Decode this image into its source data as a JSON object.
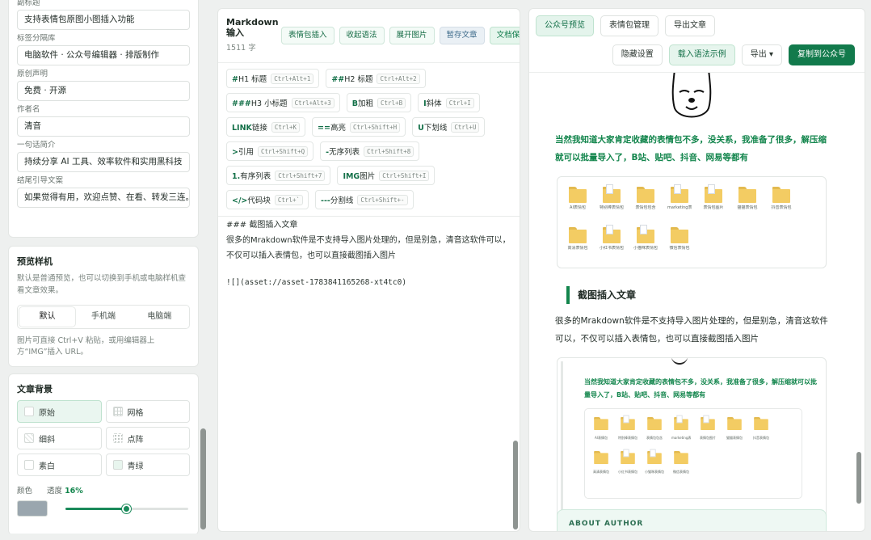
{
  "meta_fields": [
    {
      "label": "副标题",
      "value": "支持表情包原图小图插入功能"
    },
    {
      "label": "标签分隔库",
      "value": "电脑软件 · 公众号编辑器 · 排版制作"
    },
    {
      "label": "原创声明",
      "value": "免费 · 开源"
    },
    {
      "label": "作者名",
      "value": "清音"
    },
    {
      "label": "一句话简介",
      "value": "持续分享 AI 工具、效率软件和实用黑科技"
    },
    {
      "label": "结尾引导文案",
      "value": "如果觉得有用，欢迎点赞、在看、转发三连。"
    }
  ],
  "preview": {
    "title": "预览样机",
    "desc": "默认是普通预览，也可以切换到手机或电脑样机查看文章效果。",
    "tabs": [
      "默认",
      "手机端",
      "电脑端"
    ],
    "active_tab": 0,
    "hint": "图片可直接 Ctrl+V 粘贴，或用编辑器上方“IMG”插入 URL。"
  },
  "background": {
    "title": "文章背景",
    "options": [
      {
        "label": "原始",
        "swatch": "plain"
      },
      {
        "label": "网格",
        "swatch": "grid"
      },
      {
        "label": "细斜",
        "swatch": "stripe"
      },
      {
        "label": "点阵",
        "swatch": "dot"
      },
      {
        "label": "素白",
        "swatch": "plain"
      },
      {
        "label": "青绿",
        "swatch": "green"
      }
    ],
    "active": 0,
    "color_label": "颜色",
    "opacity_label": "透度",
    "opacity_value": "16%",
    "opacity_fraction": 0.5,
    "swatch_color": "#9aa6ae"
  },
  "editor": {
    "title": "Markdown 输入",
    "count": "1511 字",
    "actions": [
      "表情包插入",
      "收起语法",
      "展开图片",
      "暂存文章",
      "文档保存"
    ],
    "tools": [
      [
        {
          "key": "#",
          "label": "H1 标题",
          "kbd": "Ctrl+Alt+1"
        },
        {
          "key": "##",
          "label": "H2 标题",
          "kbd": "Ctrl+Alt+2"
        }
      ],
      [
        {
          "key": "###",
          "label": "H3 小标题",
          "kbd": "Ctrl+Alt+3"
        },
        {
          "key": "B",
          "label": "加粗",
          "kbd": "Ctrl+B"
        },
        {
          "key": "I",
          "label": "斜体",
          "kbd": "Ctrl+I"
        }
      ],
      [
        {
          "key": "LINK",
          "label": "链接",
          "kbd": "Ctrl+K"
        },
        {
          "key": "==",
          "label": "高亮",
          "kbd": "Ctrl+Shift+H"
        },
        {
          "key": "U",
          "label": "下划线",
          "kbd": "Ctrl+U"
        }
      ],
      [
        {
          "key": ">",
          "label": "引用",
          "kbd": "Ctrl+Shift+Q"
        },
        {
          "key": "-",
          "label": "无序列表",
          "kbd": "Ctrl+Shift+8"
        }
      ],
      [
        {
          "key": "1.",
          "label": "有序列表",
          "kbd": "Ctrl+Shift+7"
        },
        {
          "key": "IMG",
          "label": "图片",
          "kbd": "Ctrl+Shift+I"
        }
      ],
      [
        {
          "key": "</>",
          "label": "代码块",
          "kbd": "Ctrl+`"
        },
        {
          "key": "---",
          "label": "分割线",
          "kbd": "Ctrl+Shift+-"
        }
      ]
    ],
    "content_heading": "### 截图插入文章",
    "content_para": "很多的Mrakdown软件是不支持导入图片处理的，但是别急，清音这软件可以，不仅可以插入表情包，也可以直接截图插入图片",
    "content_code": "![](asset://asset-1783841165268-xt4tc0)"
  },
  "preview_panel": {
    "tabs": [
      "公众号预览",
      "表情包管理",
      "导出文章"
    ],
    "active_tab": 0,
    "actions": [
      "隐藏设置",
      "载入语法示例",
      "导出 ▾",
      "复制到公众号"
    ],
    "green_para": "当然我知道大家肯定收藏的表情包不多，没关系，我准备了很多，解压缩就可以批量导入了，B站、贴吧、抖音、网易等都有",
    "folders": [
      {
        "name": "AI表情包",
        "doc": false
      },
      {
        "name": "特别棒表情包",
        "doc": true
      },
      {
        "name": "表情包包含",
        "doc": false
      },
      {
        "name": "marketing表情",
        "doc": true
      },
      {
        "name": "表情包图片",
        "doc": true
      },
      {
        "name": "猫猫表情包",
        "doc": false
      },
      {
        "name": "抖音表情包",
        "doc": false
      },
      {
        "name": "高清表情包",
        "doc": false
      },
      {
        "name": "小红书表情包",
        "doc": true
      },
      {
        "name": "小猫咪表情包",
        "doc": true
      },
      {
        "name": "微信表情包",
        "doc": false
      }
    ],
    "h3": "截图插入文章",
    "body_para": "很多的Mrakdown软件是不支持导入图片处理的，但是别急，清音这软件可以，不仅可以插入表情包，也可以直接截图插入图片",
    "shot_green": "当然我知道大家肯定收藏的表情包不多，没关系，我准备了很多，解压缩就可以批量导入了，B站、贴吧、抖音、网易等都有",
    "about": "ABOUT AUTHOR"
  },
  "colors": {
    "accent": "#127a4c",
    "accent_text": "#12854c"
  }
}
